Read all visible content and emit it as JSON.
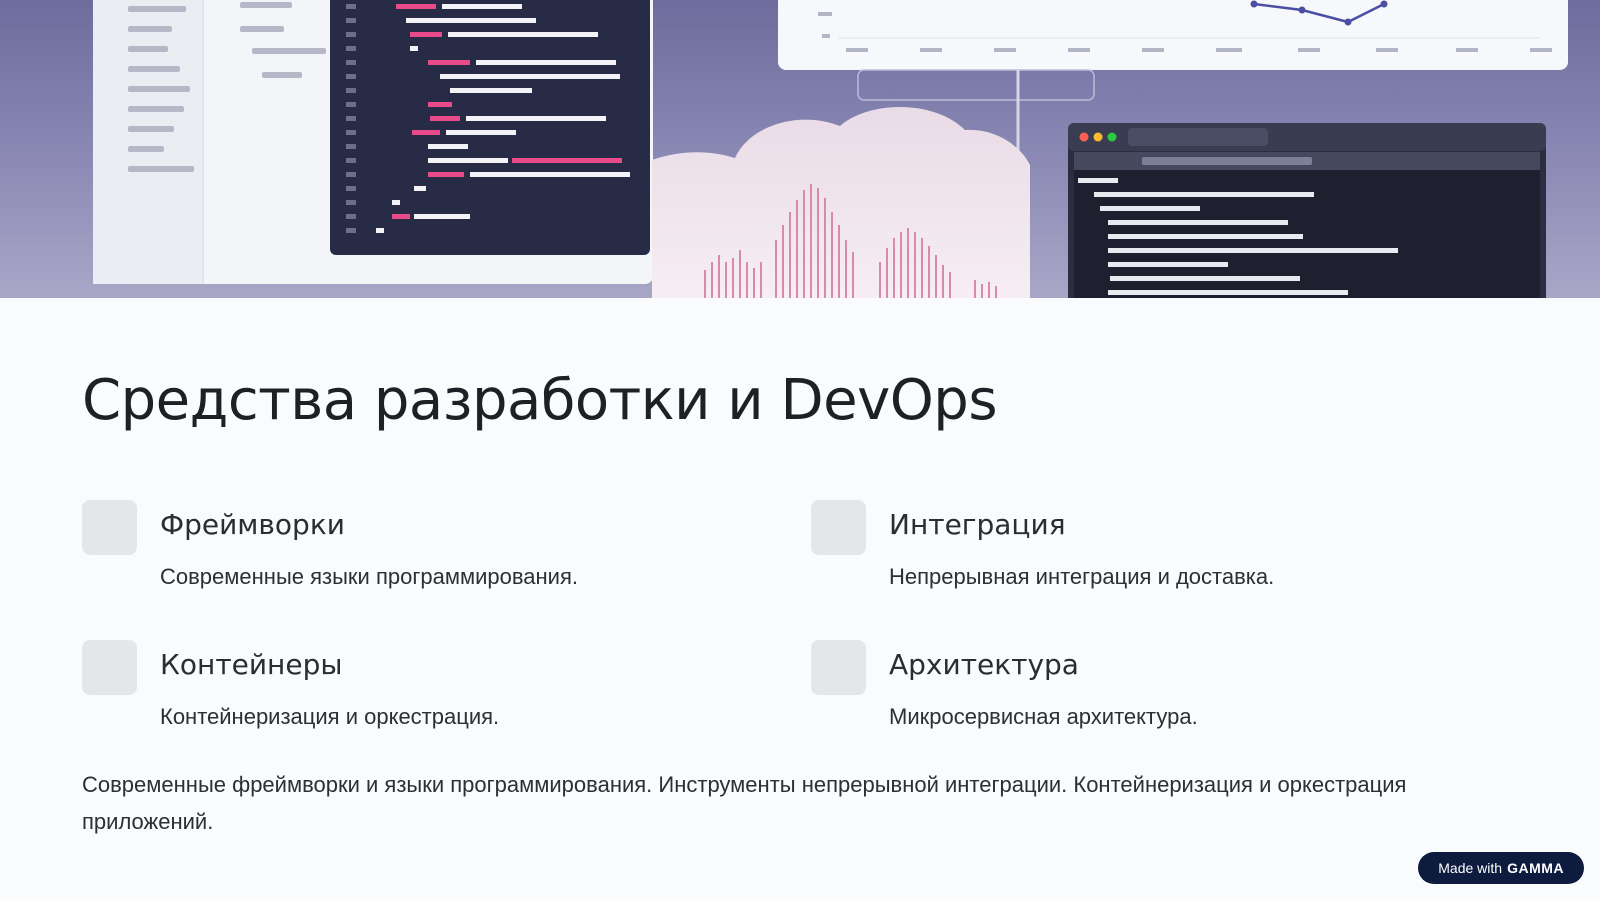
{
  "slide": {
    "title": "Средства разработки и DevOps",
    "features": [
      {
        "title": "Фреймворки",
        "description": "Современные языки программирования."
      },
      {
        "title": "Интеграция",
        "description": "Непрерывная интеграция и доставка."
      },
      {
        "title": "Контейнеры",
        "description": "Контейнеризация и оркестрация."
      },
      {
        "title": "Архитектура",
        "description": "Микросервисная архитектура."
      }
    ],
    "summary": "Современные фреймворки и языки программирования. Инструменты непрерывной интеграции. Контейнеризация и оркестрация приложений."
  },
  "badge": {
    "prefix": "Made with",
    "brand": "GAMMA"
  },
  "colors": {
    "background": "#fafbfc",
    "hero": "#7b79a8",
    "code_panel": "#272b45",
    "chip": "#e4e6ea",
    "badge": "#0d1b3e"
  },
  "icons": [
    "window-controls-icon",
    "code-editor-illustration",
    "line-chart-illustration",
    "terminal-illustration"
  ]
}
